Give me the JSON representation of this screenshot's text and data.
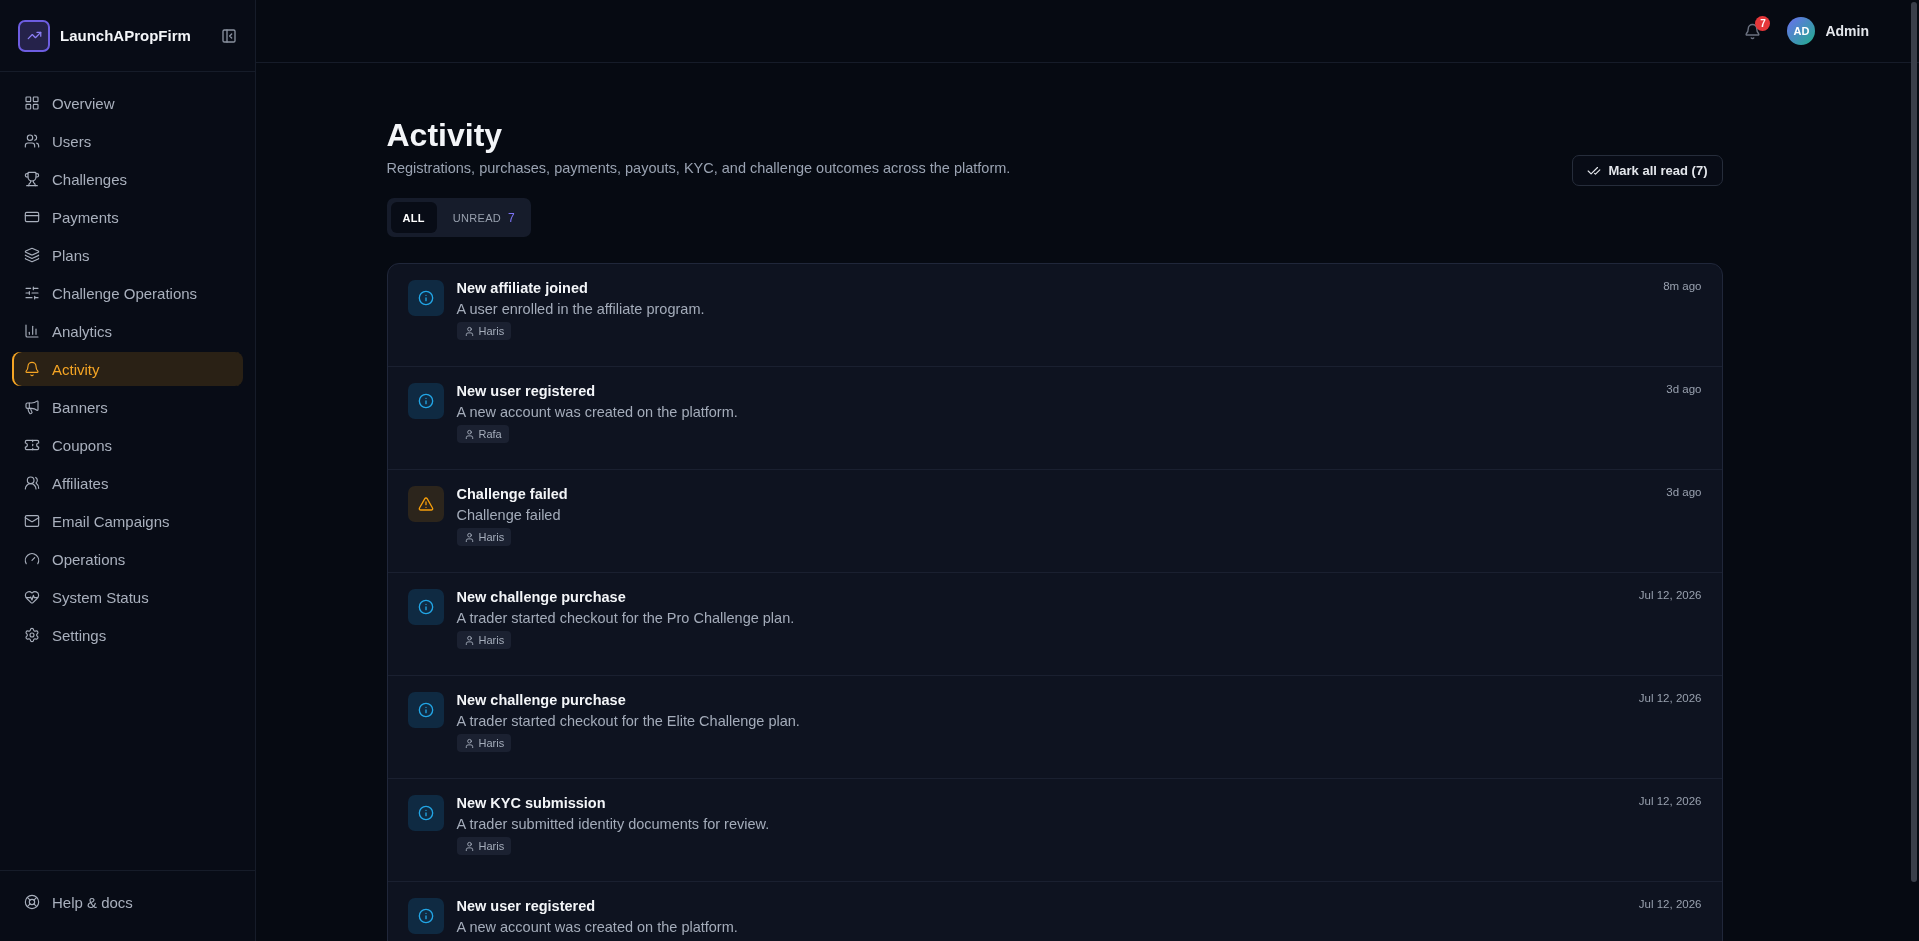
{
  "brand": {
    "name": "LaunchAPropFirm"
  },
  "sidebar": {
    "items": [
      {
        "label": "Overview",
        "selected": false
      },
      {
        "label": "Users",
        "selected": false
      },
      {
        "label": "Challenges",
        "selected": false
      },
      {
        "label": "Payments",
        "selected": false
      },
      {
        "label": "Plans",
        "selected": false
      },
      {
        "label": "Challenge Operations",
        "selected": false
      },
      {
        "label": "Analytics",
        "selected": false
      },
      {
        "label": "Activity",
        "selected": true
      },
      {
        "label": "Banners",
        "selected": false
      },
      {
        "label": "Coupons",
        "selected": false
      },
      {
        "label": "Affiliates",
        "selected": false
      },
      {
        "label": "Email Campaigns",
        "selected": false
      },
      {
        "label": "Operations",
        "selected": false
      },
      {
        "label": "System Status",
        "selected": false
      },
      {
        "label": "Settings",
        "selected": false
      }
    ],
    "footer": "Help & docs"
  },
  "header": {
    "notification_count": "7",
    "avatar": "AD",
    "user": "Admin"
  },
  "page": {
    "title": "Activity",
    "subtitle": "Registrations, purchases, payments, payouts, KYC, and challenge outcomes across the platform.",
    "mark_all_button": "Mark all read (7)"
  },
  "filters": [
    {
      "label": "ALL",
      "selected": true
    },
    {
      "label": "UNREAD",
      "count": "7",
      "selected": false
    }
  ],
  "activities": [
    {
      "kind": "info",
      "title": "New affiliate joined",
      "description": "A user enrolled in the affiliate program.",
      "user": "Haris",
      "time": "8m ago"
    },
    {
      "kind": "info",
      "title": "New user registered",
      "description": "A new account was created on the platform.",
      "user": "Rafa",
      "time": "3d ago"
    },
    {
      "kind": "warning",
      "title": "Challenge failed",
      "description": "Challenge failed",
      "user": "Haris",
      "time": "3d ago"
    },
    {
      "kind": "info",
      "title": "New challenge purchase",
      "description": "A trader started checkout for the Pro Challenge plan.",
      "user": "Haris",
      "time": "Jul 12, 2026"
    },
    {
      "kind": "info",
      "title": "New challenge purchase",
      "description": "A trader started checkout for the Elite Challenge plan.",
      "user": "Haris",
      "time": "Jul 12, 2026"
    },
    {
      "kind": "info",
      "title": "New KYC submission",
      "description": "A trader submitted identity documents for review.",
      "user": "Haris",
      "time": "Jul 12, 2026"
    },
    {
      "kind": "info",
      "title": "New user registered",
      "description": "A new account was created on the platform.",
      "time": "Jul 12, 2026"
    }
  ]
}
